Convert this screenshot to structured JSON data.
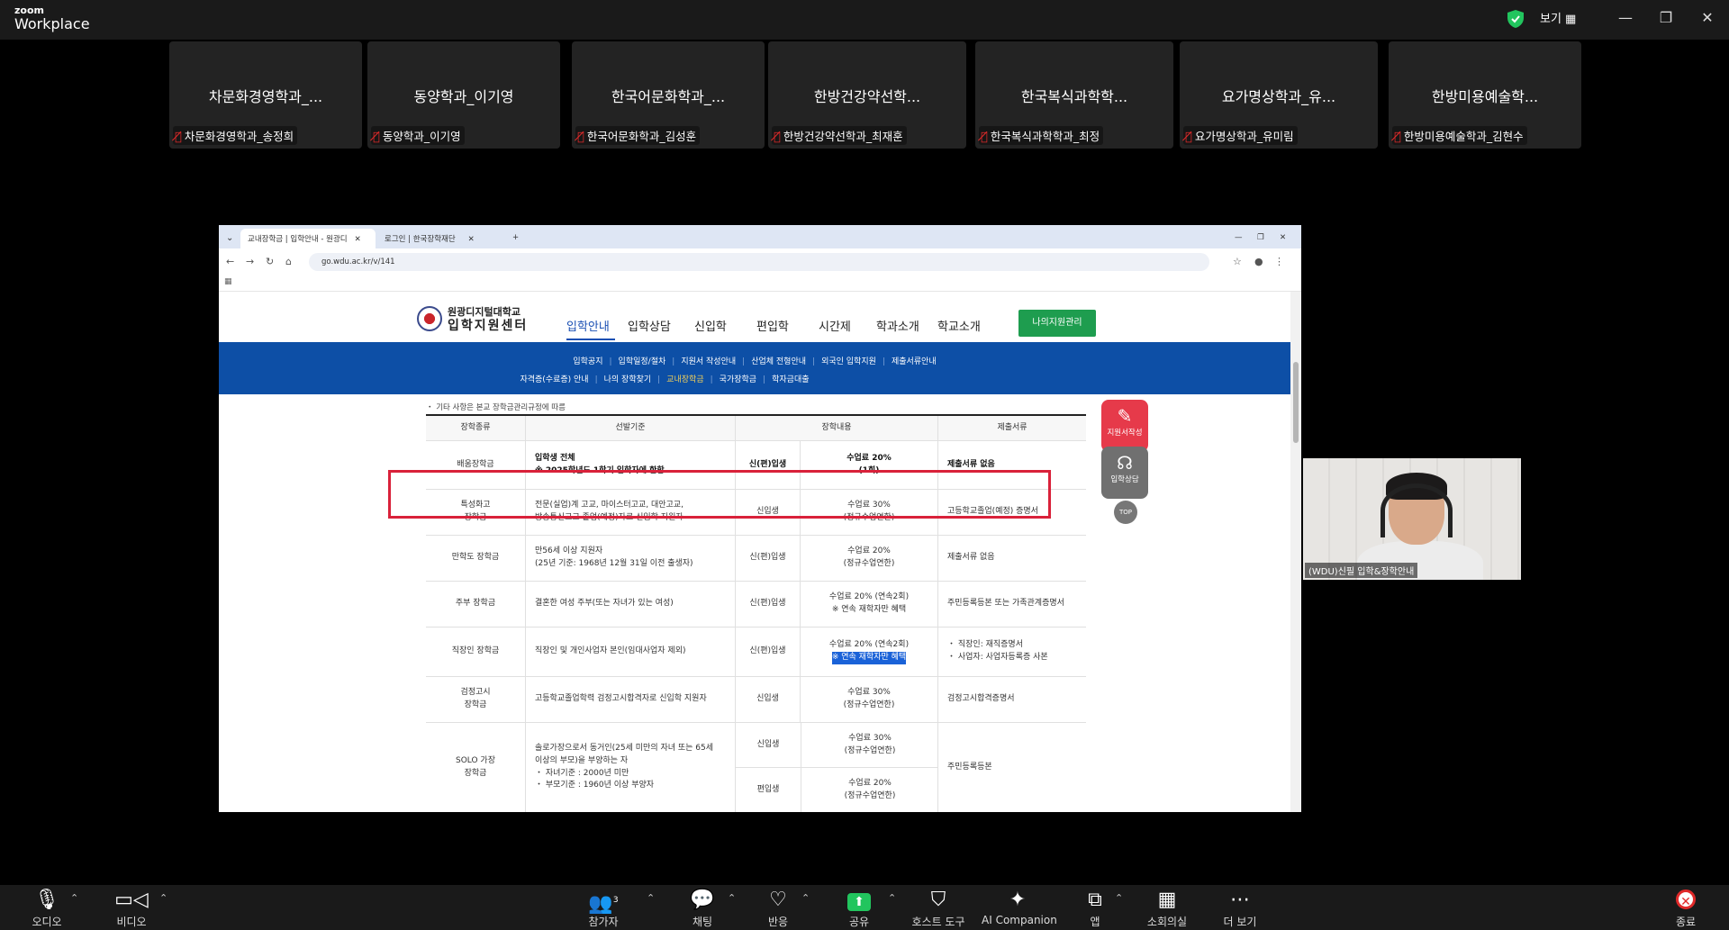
{
  "zoom": {
    "brand_small": "zoom",
    "brand_big": "Workplace",
    "view_label": "보기 ▦",
    "window": {
      "minimize": "—",
      "restore": "❐",
      "close": "✕"
    }
  },
  "gallery": [
    {
      "display_name": "차문화경영학과_...",
      "label": "차문화경영학과_송정희"
    },
    {
      "display_name": "동양학과_이기영",
      "label": "동양학과_이기영"
    },
    {
      "display_name": "한국어문화학과_...",
      "label": "한국어문화학과_김성훈"
    },
    {
      "display_name": "한방건강약선학...",
      "label": "한방건강약선학과_최재훈"
    },
    {
      "display_name": "한국복식과학학...",
      "label": "한국복식과학학과_최정"
    },
    {
      "display_name": "요가명상학과_유...",
      "label": "요가명상학과_유미림"
    },
    {
      "display_name": "한방미용예술학...",
      "label": "한방미용예술학과_김현수"
    }
  ],
  "browser": {
    "tabs": [
      {
        "title": "교내장학금 | 입학안내 - 원광디",
        "close": "✕"
      },
      {
        "title": "로그인 | 한국장학재단",
        "close": "✕"
      }
    ],
    "new_tab": "+",
    "window": {
      "minimize": "—",
      "restore": "❐",
      "close": "✕"
    },
    "url": "go.wdu.ac.kr/v/141"
  },
  "site": {
    "logo_line1": "원광디지털대학교",
    "logo_line2": "입학지원센터",
    "gnb": [
      "입학안내",
      "입학상담",
      "신입학",
      "편입학",
      "시간제",
      "학과소개",
      "학교소개"
    ],
    "my_button": "나의지원관리",
    "subnav_row1": [
      "입학공지",
      "입학일정/절차",
      "지원서 작성안내",
      "산업체 전형안내",
      "외국인 입학지원",
      "제출서류안내"
    ],
    "subnav_row2": [
      "자격증(수료증) 안내",
      "나의 장학찾기",
      "교내장학금",
      "국가장학금",
      "학자금대출"
    ],
    "note": "・ 기타 사항은 본교 장학금관리규정에 따름",
    "float_buttons": {
      "apply": "지원서작성",
      "consult": "입학상담",
      "top": "TOP"
    }
  },
  "table": {
    "headers": [
      "장학종류",
      "선발기준",
      "장학내용",
      "제출서류"
    ],
    "rows": [
      {
        "type": "배움장학금",
        "criteria1": "입학생 전체",
        "criteria2": "※ 2025학년도 1학기 입학자에 한함",
        "target": "신(편)입생",
        "benefit1": "수업료 20%",
        "benefit2": "(1회)",
        "docs": "제출서류 없음"
      },
      {
        "type1": "특성화고",
        "type2": "장학금",
        "criteria1": "전문(실업)계 고교, 마이스터고교, 대안고교,",
        "criteria2": "방송통신고교 졸업(예정)자로 신입학 지원자",
        "target": "신입생",
        "benefit1": "수업료 30%",
        "benefit2": "(정규수업연한)",
        "docs": "고등학교졸업(예정) 증명서"
      },
      {
        "type": "만학도 장학금",
        "criteria1": "만56세 이상 지원자",
        "criteria2": "(25년 기준: 1968년 12월 31일 이전 출생자)",
        "target": "신(편)입생",
        "benefit1": "수업료 20%",
        "benefit2": "(정규수업연한)",
        "docs": "제출서류 없음"
      },
      {
        "type": "주부 장학금",
        "criteria1": "결혼한 여성 주부(또는 자녀가 있는 여성)",
        "target": "신(편)입생",
        "benefit1": "수업료 20% (연속2회)",
        "benefit2": "※ 연속 재학자만 혜택",
        "docs": "주민등록등본 또는 가족관계증명서"
      },
      {
        "type": "직장인 장학금",
        "criteria1": "직장인 및 개인사업자 본인(임대사업자 제외)",
        "target": "신(편)입생",
        "benefit1": "수업료 20% (연속2회)",
        "benefit2": "※ 연속 재학자만 혜택",
        "docs1": "・ 직장인: 재직증명서",
        "docs2": "・ 사업자: 사업자등록증 사본"
      },
      {
        "type1": "검정고시",
        "type2": "장학금",
        "criteria1": "고등학교졸업학력 검정고시합격자로 신입학 지원자",
        "target": "신입생",
        "benefit1": "수업료 30%",
        "benefit2": "(정규수업연한)",
        "docs": "검정고시합격증명서"
      },
      {
        "type1": "SOLO 가장",
        "type2": "장학금",
        "criteria1": "솔로가장으로서 동거인(25세 미만의 자녀 또는 65세",
        "criteria2": "이상의 부모)을 부양하는 자",
        "criteria3": "・ 자녀기준 : 2000년 미만",
        "criteria4": "・ 부모기준 : 1960년 이상 부양자",
        "target1": "신입생",
        "target2": "편입생",
        "benefit1a": "수업료 30%",
        "benefit1b": "(정규수업연한)",
        "benefit2a": "수업료 20%",
        "benefit2b": "(정규수업연한)",
        "docs": "주민등록등본"
      }
    ]
  },
  "speaker_label": "(WDU)신필 입학&장학안내",
  "toolbar": {
    "audio": "오디오",
    "video": "비디오",
    "participants": "참가자",
    "participants_count": "3",
    "chat": "채팅",
    "reactions": "반응",
    "share": "공유",
    "host_tools": "호스트 도구",
    "ai_companion": "AI Companion",
    "apps": "앱",
    "breakout": "소회의실",
    "more": "더 보기",
    "end": "종료"
  },
  "colors": {
    "zoom_bg": "#1a1a1a",
    "site_blue": "#0d4fa6",
    "site_green": "#1e9d4f",
    "highlight_red": "#d9213a",
    "share_green": "#22c55e"
  }
}
